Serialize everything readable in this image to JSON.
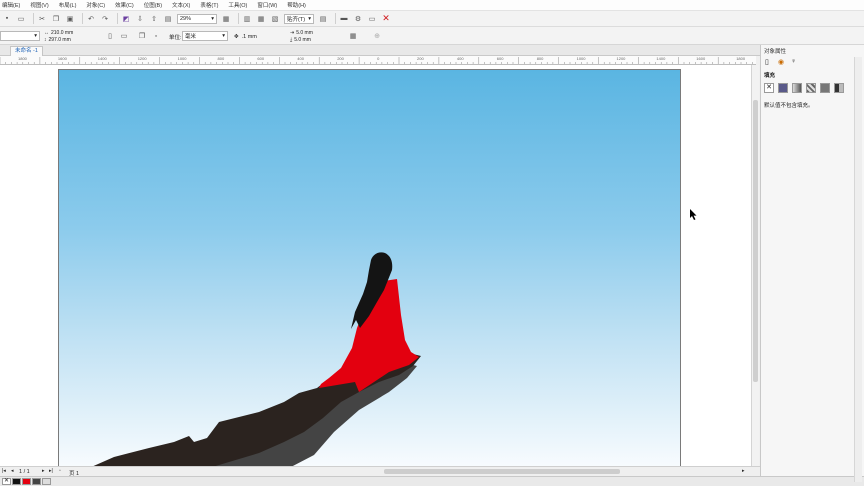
{
  "menu": [
    "编辑(E)",
    "视图(V)",
    "布局(L)",
    "对象(C)",
    "效果(C)",
    "位图(B)",
    "文本(X)",
    "表格(T)",
    "工具(O)",
    "窗口(W)",
    "帮助(H)"
  ],
  "toolbar": {
    "zoom": "29%",
    "snap_label": "贴齐(T)"
  },
  "propbar": {
    "width": "210.0 mm",
    "height": "297.0 mm",
    "units_label": "单位:",
    "units_value": "毫米",
    "nudge": ".1 mm",
    "dup_x": "5.0 mm",
    "dup_y": "5.0 mm"
  },
  "doc_tab": "未命名 -1",
  "ruler_ticks": [
    "1800",
    "1600",
    "1400",
    "1200",
    "1000",
    "800",
    "600",
    "400",
    "200",
    "0",
    "200",
    "400",
    "600",
    "800",
    "1000",
    "1200",
    "1400",
    "1600",
    "1800",
    "2000",
    "2200",
    "2400",
    "2600",
    "2800",
    "3000",
    "3200",
    "3400"
  ],
  "status": {
    "page_count": "1 / 1",
    "page_tab": "页 1"
  },
  "docker": {
    "title": "对象属性",
    "fill_label": "填充",
    "fill_description": "默认值不包含填充。"
  },
  "colors": {
    "dress": "#e3000f",
    "rock_dark": "#2b231f",
    "rock_mid": "#444444",
    "sky_top": "#5ab5e2",
    "sky_bottom": "#f7fbfe"
  }
}
